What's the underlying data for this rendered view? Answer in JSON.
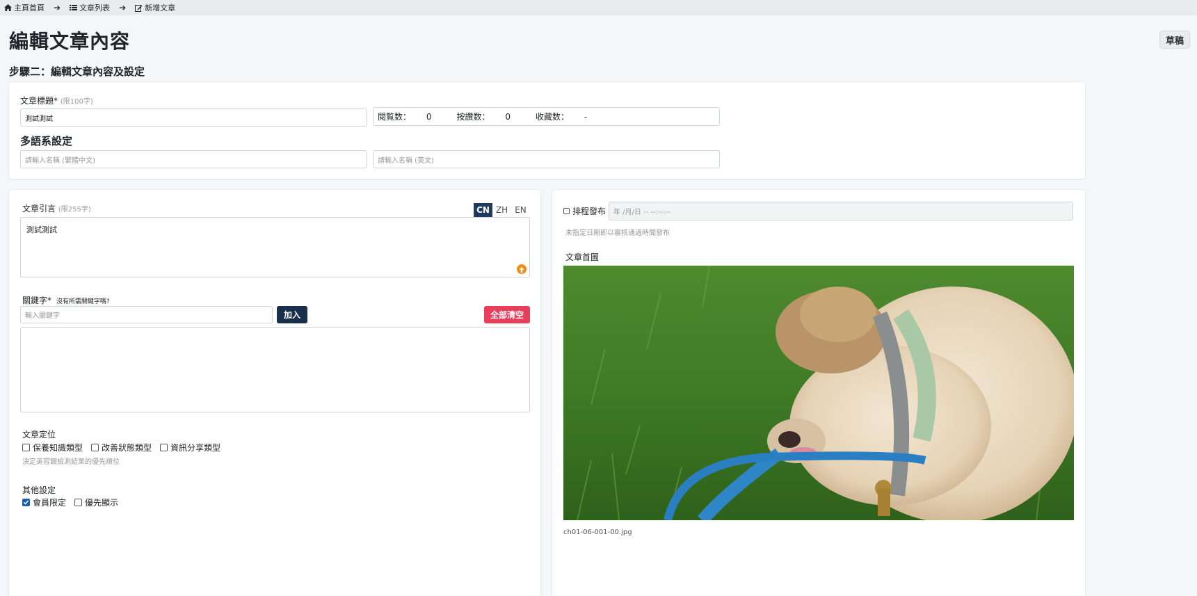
{
  "breadcrumb": {
    "home": "主頁首頁",
    "list": "文章列表",
    "current": "新增文章"
  },
  "header": {
    "title": "編輯文章內容",
    "status_badge": "草稿",
    "step": "步驟二：編輯文章內容及設定"
  },
  "article": {
    "title_label": "文章標題*",
    "title_hint": "(限100字)",
    "title_value": "測試測試",
    "stats": {
      "views": "閱覧数：",
      "views_value": "0",
      "likes": "按讚数：",
      "likes_value": "0",
      "favs": "收藏数：",
      "favs_value": "-"
    },
    "multilang_heading": "多語系設定",
    "name_zh_placeholder": "請輸入名稱 (繁體中文)",
    "name_en_placeholder": "請輸入名稱 (英文)"
  },
  "intro": {
    "label": "文章引言",
    "hint": "(限255字)",
    "tabs": [
      "CN",
      "ZH",
      "EN"
    ],
    "value": "測試測試"
  },
  "keywords": {
    "label": "關鍵字*",
    "hint": "沒有所需關鍵字嗎?",
    "placeholder": "輸入關鍵字",
    "add_button": "加入",
    "clear_button": "全部清空"
  },
  "positioning": {
    "label": "文章定位",
    "options": [
      "保養知識類型",
      "改善狀態類型",
      "資訊分享類型"
    ],
    "help": "決定美容鏡檢測結果的優先順位"
  },
  "other": {
    "label": "其他設定",
    "members_only": "會員限定",
    "members_only_checked": true,
    "priority": "優先顯示",
    "priority_checked": false
  },
  "schedule": {
    "label": "排程發布",
    "date_placeholder": "年 /月/日 -- --:--:--",
    "help": "未指定日期即以審核通過時間發布"
  },
  "cover": {
    "label": "文章首圖",
    "filename": "ch01-06-001-00.jpg"
  },
  "colors": {
    "navy": "#1a2f4b",
    "danger": "#e83e5b",
    "accent_orange": "#f08c1a"
  }
}
